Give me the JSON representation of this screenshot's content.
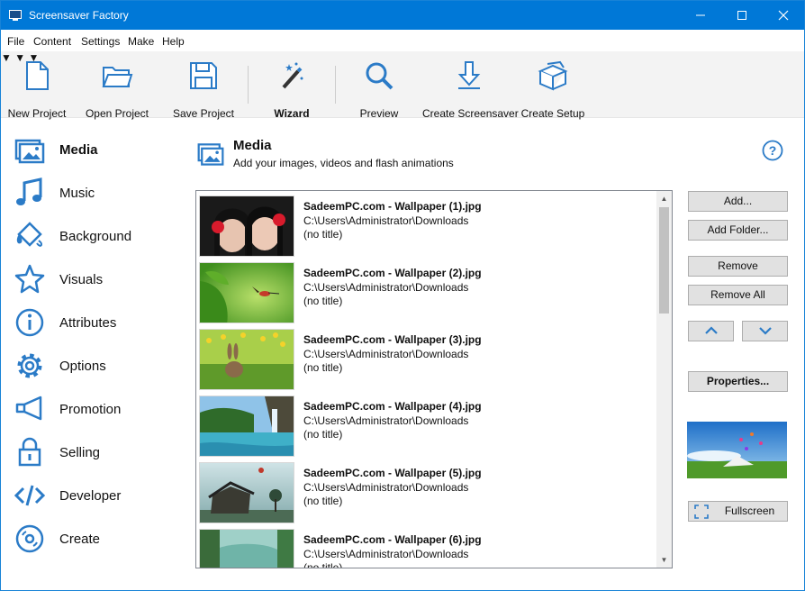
{
  "window": {
    "title": "Screensaver Factory",
    "accent_color": "#0078d7"
  },
  "menu": [
    "File",
    "Content",
    "Settings",
    "Make",
    "Help"
  ],
  "toolbar": {
    "new_project": "New Project",
    "open_project": "Open Project",
    "save_project": "Save Project",
    "wizard": "Wizard",
    "preview": "Preview",
    "create_screensaver": "Create Screensaver",
    "create_setup": "Create Setup",
    "icon_color": "#2b7bc7"
  },
  "sidebar": {
    "items": [
      {
        "label": "Media",
        "icon": "media-icon"
      },
      {
        "label": "Music",
        "icon": "music-icon"
      },
      {
        "label": "Background",
        "icon": "paint-bucket-icon"
      },
      {
        "label": "Visuals",
        "icon": "star-icon"
      },
      {
        "label": "Attributes",
        "icon": "info-icon"
      },
      {
        "label": "Options",
        "icon": "gear-icon"
      },
      {
        "label": "Promotion",
        "icon": "megaphone-icon"
      },
      {
        "label": "Selling",
        "icon": "lock-icon"
      },
      {
        "label": "Developer",
        "icon": "code-icon"
      },
      {
        "label": "Create",
        "icon": "disc-icon"
      }
    ]
  },
  "section": {
    "title": "Media",
    "subtitle": "Add your images, videos and flash animations"
  },
  "media_list": [
    {
      "name": "SadeemPC.com - Wallpaper (1).jpg",
      "path": "C:\\Users\\Administrator\\Downloads",
      "title": "(no title)"
    },
    {
      "name": "SadeemPC.com - Wallpaper (2).jpg",
      "path": "C:\\Users\\Administrator\\Downloads",
      "title": "(no title)"
    },
    {
      "name": "SadeemPC.com - Wallpaper (3).jpg",
      "path": "C:\\Users\\Administrator\\Downloads",
      "title": "(no title)"
    },
    {
      "name": "SadeemPC.com - Wallpaper (4).jpg",
      "path": "C:\\Users\\Administrator\\Downloads",
      "title": "(no title)"
    },
    {
      "name": "SadeemPC.com - Wallpaper (5).jpg",
      "path": "C:\\Users\\Administrator\\Downloads",
      "title": "(no title)"
    },
    {
      "name": "SadeemPC.com - Wallpaper (6).jpg",
      "path": "C:\\Users\\Administrator\\Downloads",
      "title": "(no title)"
    }
  ],
  "buttons": {
    "add": "Add...",
    "add_folder": "Add Folder...",
    "remove": "Remove",
    "remove_all": "Remove All",
    "properties": "Properties...",
    "fullscreen": "Fullscreen"
  }
}
